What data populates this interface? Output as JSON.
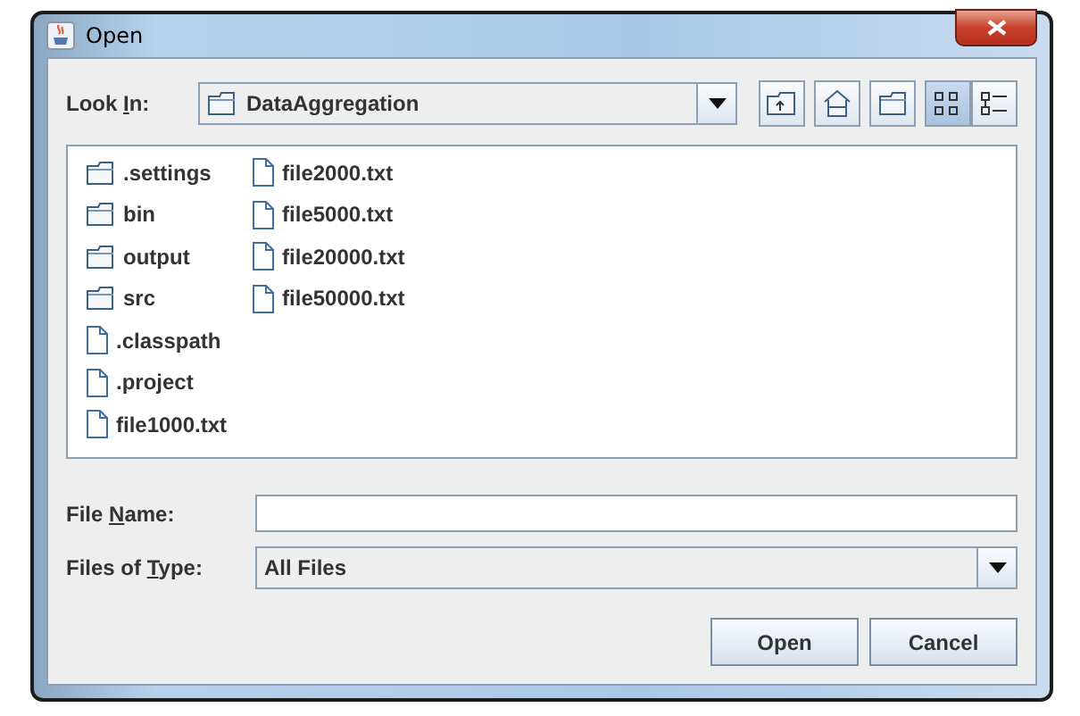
{
  "window": {
    "title": "Open"
  },
  "look_in": {
    "label_parts": [
      "Look ",
      "I",
      "n:"
    ],
    "value": "DataAggregation"
  },
  "view_buttons": [
    {
      "kind": "list",
      "selected": true
    },
    {
      "kind": "details",
      "selected": false
    }
  ],
  "files": [
    {
      "kind": "folder",
      "name": ".settings"
    },
    {
      "kind": "folder",
      "name": "bin"
    },
    {
      "kind": "folder",
      "name": "output"
    },
    {
      "kind": "folder",
      "name": "src"
    },
    {
      "kind": "file",
      "name": ".classpath"
    },
    {
      "kind": "file",
      "name": ".project"
    },
    {
      "kind": "file",
      "name": "file1000.txt"
    },
    {
      "kind": "file",
      "name": "file2000.txt"
    },
    {
      "kind": "file",
      "name": "file5000.txt"
    },
    {
      "kind": "file",
      "name": "file20000.txt"
    },
    {
      "kind": "file",
      "name": "file50000.txt"
    }
  ],
  "file_name": {
    "label_parts": [
      "File ",
      "N",
      "ame:"
    ]
  },
  "files_of_type": {
    "label_parts": [
      "Files of ",
      "T",
      "ype:"
    ],
    "value": "All Files"
  },
  "buttons": [
    "Open",
    "Cancel"
  ]
}
